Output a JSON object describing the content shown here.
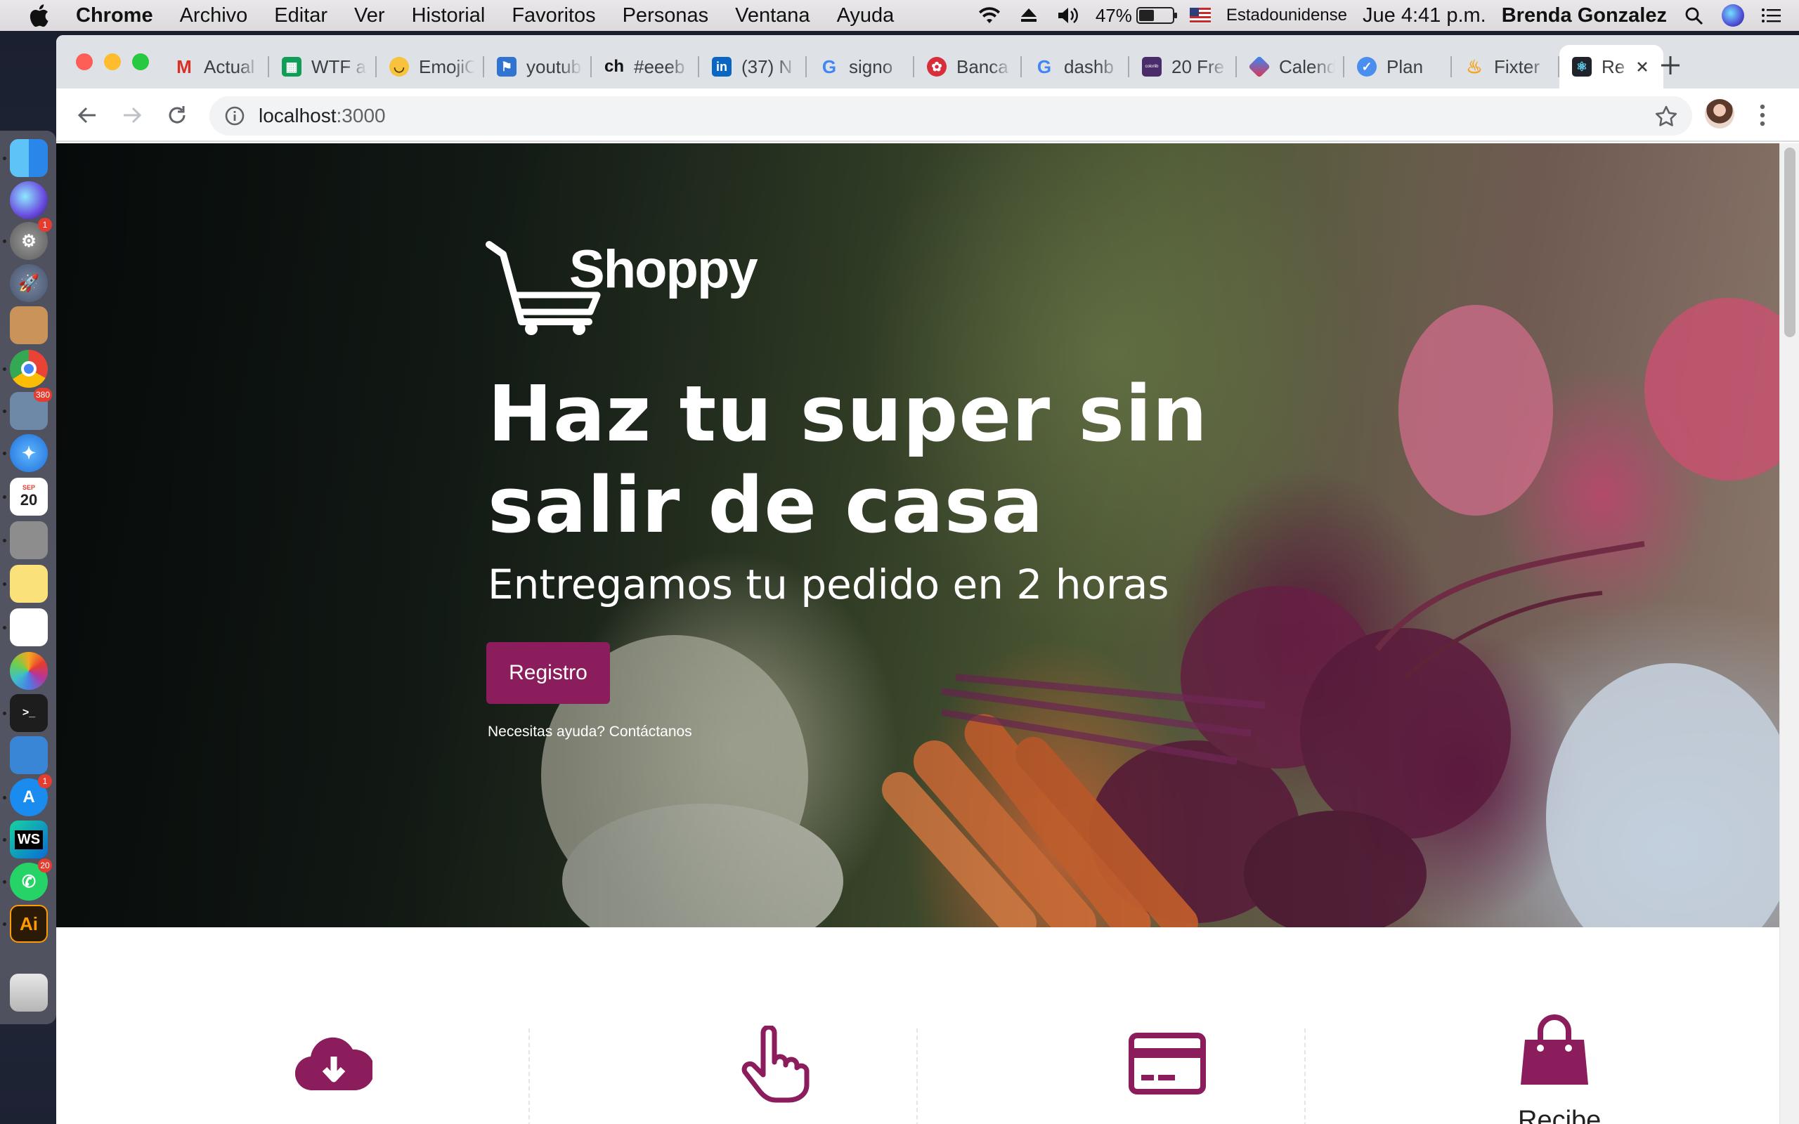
{
  "menubar": {
    "app": "Chrome",
    "menus": [
      "Archivo",
      "Editar",
      "Ver",
      "Historial",
      "Favoritos",
      "Personas",
      "Ventana",
      "Ayuda"
    ],
    "battery_pct": "47%",
    "battery_level": 0.47,
    "input_source": "Estadounidense",
    "clock": "Jue 4:41 p.m.",
    "user": "Brenda Gonzalez"
  },
  "dock": {
    "badges": {
      "launchpad": "1",
      "preview": "380",
      "appstore": "1",
      "whatsapp": "20"
    },
    "calendar_day": "20",
    "calendar_month": "SEP",
    "illustrator": "Ai",
    "webstorm": "WS"
  },
  "browser": {
    "tabs": [
      {
        "title": "Actual",
        "icon": "gmail-icon"
      },
      {
        "title": "WTF a",
        "icon": "sheets-icon"
      },
      {
        "title": "EmojiC",
        "icon": "emoji-icon"
      },
      {
        "title": "youtub",
        "icon": "flag-icon"
      },
      {
        "title": "#eeeb",
        "icon": "ch-icon",
        "icon_text": "ch"
      },
      {
        "title": "(37) N",
        "icon": "linkedin-icon",
        "icon_text": "in"
      },
      {
        "title": "signo",
        "icon": "google-icon",
        "icon_text": "G"
      },
      {
        "title": "Banca",
        "icon": "bank-icon"
      },
      {
        "title": "dashb",
        "icon": "google-icon",
        "icon_text": "G"
      },
      {
        "title": "20 Fre",
        "icon": "colorlib-icon",
        "icon_text": "colorlib"
      },
      {
        "title": "Calend",
        "icon": "calendar-icon"
      },
      {
        "title": "Plan",
        "icon": "check-icon"
      },
      {
        "title": "Fixter",
        "icon": "flame-icon"
      },
      {
        "title": "Re",
        "icon": "react-icon",
        "active": true
      }
    ],
    "url_host": "localhost",
    "url_port": ":3000"
  },
  "hero": {
    "logo_text": "Shoppy",
    "headline": "Haz tu super sin salir de casa",
    "subhead": "Entregamos tu pedido en 2 horas",
    "cta": "Registro",
    "help": "Necesitas ayuda? Contáctanos"
  },
  "features": [
    {
      "icon": "cloud-download-icon",
      "label": ""
    },
    {
      "icon": "pointer-hand-icon",
      "label": ""
    },
    {
      "icon": "credit-card-icon",
      "label": ""
    },
    {
      "icon": "shopping-bag-icon",
      "label": "Recibe"
    }
  ],
  "colors": {
    "brand": "#8b1d5c"
  }
}
